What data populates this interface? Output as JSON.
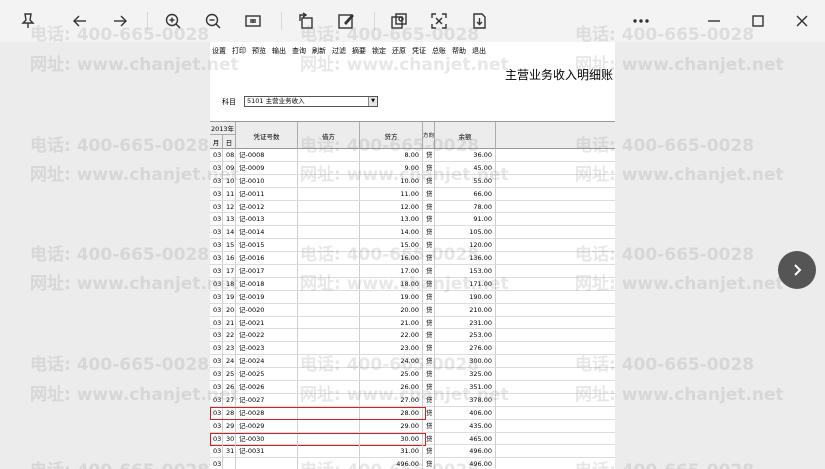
{
  "toolbar": {
    "buttons": [
      {
        "name": "pin-icon"
      },
      {
        "name": "back-icon"
      },
      {
        "name": "forward-icon"
      },
      {
        "name": "zoom-in-icon"
      },
      {
        "name": "zoom-out-icon"
      },
      {
        "name": "actual-size-icon"
      },
      {
        "name": "rotate-icon"
      },
      {
        "name": "edit-icon"
      },
      {
        "name": "image-search-icon"
      },
      {
        "name": "ocr-text-icon"
      },
      {
        "name": "download-icon"
      },
      {
        "name": "more-icon"
      },
      {
        "name": "minimize-icon"
      },
      {
        "name": "maximize-icon"
      },
      {
        "name": "close-icon"
      }
    ]
  },
  "document": {
    "menu": [
      "设置",
      "打印",
      "预览",
      "输出",
      "查询",
      "刷新",
      "过滤",
      "摘要",
      "锁定",
      "还原",
      "凭证",
      "总账",
      "帮助",
      "退出"
    ],
    "title": "主营业务收入明细账",
    "subject_label": "科目",
    "subject_value": "5101 主营业务收入",
    "header": {
      "year": "2013年",
      "month": "月",
      "day": "日",
      "voucher": "凭证号数",
      "debit": "借方",
      "credit": "贷方",
      "direction": "方向",
      "balance": "余额"
    },
    "rows": [
      {
        "m": "03",
        "d": "08",
        "v": "记-0008",
        "credit": "8.00",
        "dir": "贷",
        "bal": "36.00"
      },
      {
        "m": "03",
        "d": "09",
        "v": "记-0009",
        "credit": "9.00",
        "dir": "贷",
        "bal": "45.00"
      },
      {
        "m": "03",
        "d": "10",
        "v": "记-0010",
        "credit": "10.00",
        "dir": "贷",
        "bal": "55.00"
      },
      {
        "m": "03",
        "d": "11",
        "v": "记-0011",
        "credit": "11.00",
        "dir": "贷",
        "bal": "66.00"
      },
      {
        "m": "03",
        "d": "12",
        "v": "记-0012",
        "credit": "12.00",
        "dir": "贷",
        "bal": "78.00"
      },
      {
        "m": "03",
        "d": "13",
        "v": "记-0013",
        "credit": "13.00",
        "dir": "贷",
        "bal": "91.00"
      },
      {
        "m": "03",
        "d": "14",
        "v": "记-0014",
        "credit": "14.00",
        "dir": "贷",
        "bal": "105.00"
      },
      {
        "m": "03",
        "d": "15",
        "v": "记-0015",
        "credit": "15.00",
        "dir": "贷",
        "bal": "120.00"
      },
      {
        "m": "03",
        "d": "16",
        "v": "记-0016",
        "credit": "16.00",
        "dir": "贷",
        "bal": "136.00"
      },
      {
        "m": "03",
        "d": "17",
        "v": "记-0017",
        "credit": "17.00",
        "dir": "贷",
        "bal": "153.00"
      },
      {
        "m": "03",
        "d": "18",
        "v": "记-0018",
        "credit": "18.00",
        "dir": "贷",
        "bal": "171.00"
      },
      {
        "m": "03",
        "d": "19",
        "v": "记-0019",
        "credit": "19.00",
        "dir": "贷",
        "bal": "190.00"
      },
      {
        "m": "03",
        "d": "20",
        "v": "记-0020",
        "credit": "20.00",
        "dir": "贷",
        "bal": "210.00"
      },
      {
        "m": "03",
        "d": "21",
        "v": "记-0021",
        "credit": "21.00",
        "dir": "贷",
        "bal": "231.00"
      },
      {
        "m": "03",
        "d": "22",
        "v": "记-0022",
        "credit": "22.00",
        "dir": "贷",
        "bal": "253.00"
      },
      {
        "m": "03",
        "d": "23",
        "v": "记-0023",
        "credit": "23.00",
        "dir": "贷",
        "bal": "276.00"
      },
      {
        "m": "03",
        "d": "24",
        "v": "记-0024",
        "credit": "24.00",
        "dir": "贷",
        "bal": "300.00"
      },
      {
        "m": "03",
        "d": "25",
        "v": "记-0025",
        "credit": "25.00",
        "dir": "贷",
        "bal": "325.00"
      },
      {
        "m": "03",
        "d": "26",
        "v": "记-0026",
        "credit": "26.00",
        "dir": "贷",
        "bal": "351.00"
      },
      {
        "m": "03",
        "d": "27",
        "v": "记-0027",
        "credit": "27.00",
        "dir": "贷",
        "bal": "378.00"
      },
      {
        "m": "03",
        "d": "28",
        "v": "记-0028",
        "credit": "28.00",
        "dir": "贷",
        "bal": "406.00"
      },
      {
        "m": "03",
        "d": "29",
        "v": "记-0029",
        "credit": "29.00",
        "dir": "贷",
        "bal": "435.00"
      },
      {
        "m": "03",
        "d": "30",
        "v": "记-0030",
        "credit": "30.00",
        "dir": "贷",
        "bal": "465.00"
      },
      {
        "m": "03",
        "d": "31",
        "v": "记-0031",
        "credit": "31.00",
        "dir": "贷",
        "bal": "496.00"
      },
      {
        "m": "03",
        "d": "",
        "v": "",
        "credit": "496.00",
        "dir": "贷",
        "bal": "496.00"
      }
    ],
    "highlighted_rows": [
      20,
      22
    ]
  },
  "watermark": {
    "phone": "电话: 400-665-0028",
    "site": "网址: www.chanjet.net"
  },
  "colors": {
    "highlight": "#d81e1e",
    "toolbar_bg": "#f3f3f3",
    "page_bg": "#ececec"
  }
}
